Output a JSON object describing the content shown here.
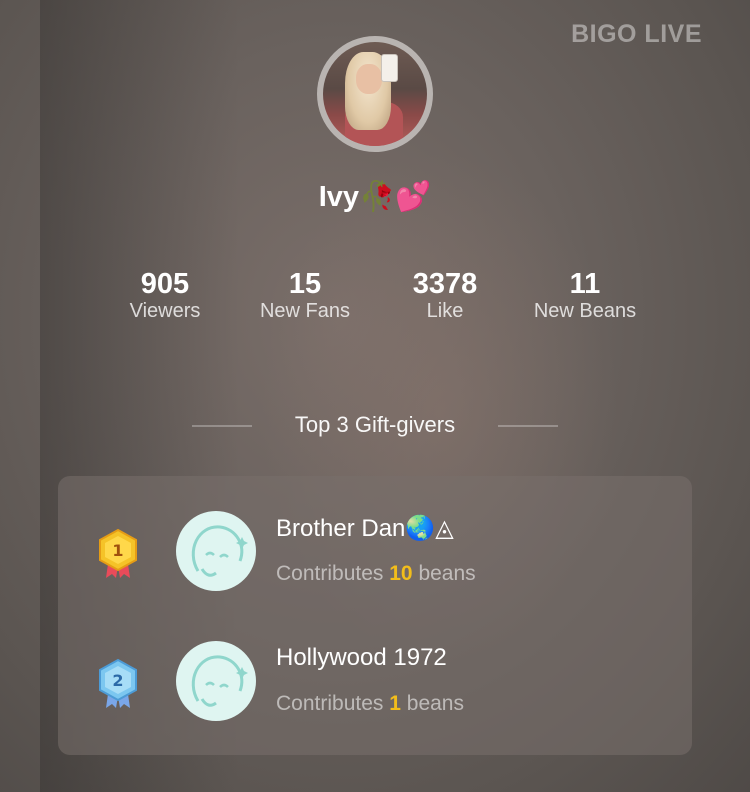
{
  "brand": "BIGO LIVE",
  "profile": {
    "name": "Ivy🥀💕"
  },
  "stats": [
    {
      "value": "905",
      "label": "Viewers"
    },
    {
      "value": "15",
      "label": "New Fans"
    },
    {
      "value": "3378",
      "label": "Like"
    },
    {
      "value": "11",
      "label": "New Beans"
    }
  ],
  "section_title": "Top 3 Gift-givers",
  "givers": [
    {
      "rank": "1",
      "name": "Brother Dan🌏◬",
      "contrib_prefix": "Contributes",
      "beans": "10",
      "contrib_suffix": "beans",
      "medal_color": "#f5c328"
    },
    {
      "rank": "2",
      "name": "Hollywood 1972",
      "contrib_prefix": "Contributes",
      "beans": "1",
      "contrib_suffix": "beans",
      "medal_color": "#7cc7f0"
    }
  ],
  "colors": {
    "accent_beans": "#f2bd1b"
  }
}
